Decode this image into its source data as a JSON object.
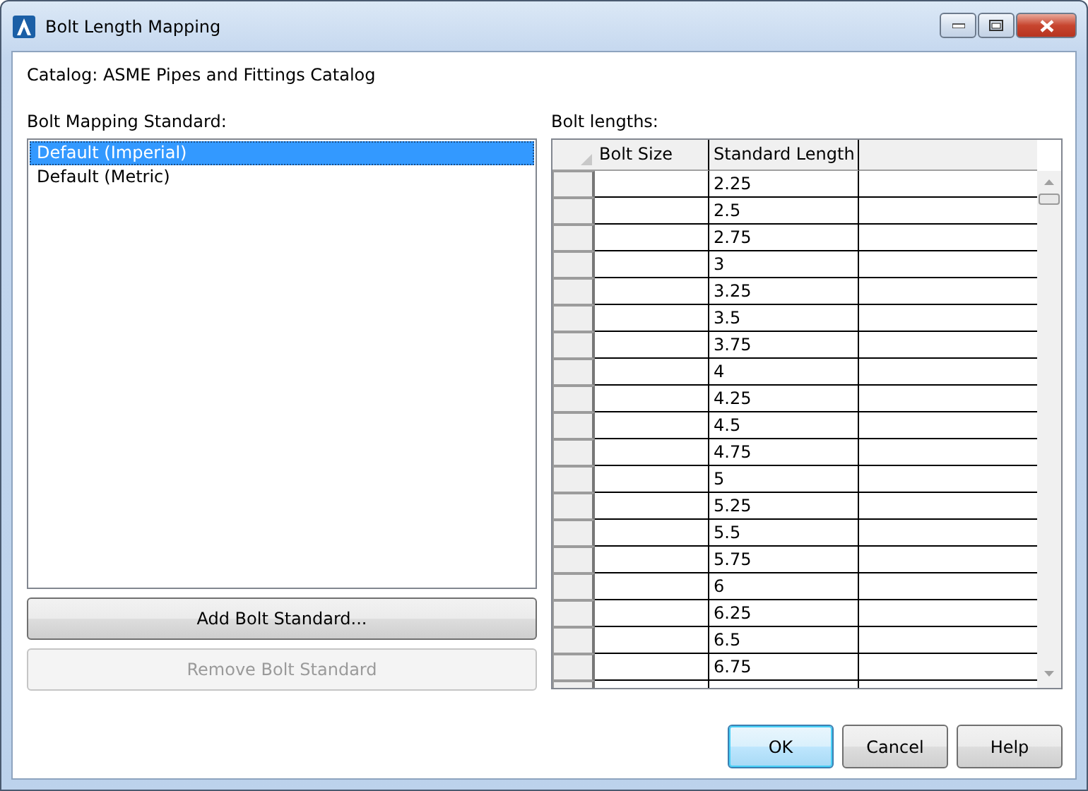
{
  "window": {
    "title": "Bolt Length Mapping"
  },
  "catalog": "Catalog: ASME Pipes and Fittings Catalog",
  "standards": {
    "label": "Bolt Mapping Standard:",
    "items": [
      {
        "label": "Default (Imperial)",
        "selected": true
      },
      {
        "label": "Default (Metric)",
        "selected": false
      }
    ]
  },
  "standard_buttons": [
    {
      "label": "Add Bolt Standard...",
      "disabled": false
    },
    {
      "label": "Remove Bolt Standard",
      "disabled": true
    }
  ],
  "bolt_lengths": {
    "label": "Bolt lengths:",
    "columns": [
      "Bolt Size",
      "Standard Length"
    ],
    "rows": [
      {
        "standard_length": "2.25"
      },
      {
        "standard_length": "2.5"
      },
      {
        "standard_length": "2.75"
      },
      {
        "standard_length": "3"
      },
      {
        "standard_length": "3.25"
      },
      {
        "standard_length": "3.5"
      },
      {
        "standard_length": "3.75"
      },
      {
        "standard_length": "4"
      },
      {
        "standard_length": "4.25"
      },
      {
        "standard_length": "4.5"
      },
      {
        "standard_length": "4.75"
      },
      {
        "standard_length": "5"
      },
      {
        "standard_length": "5.25"
      },
      {
        "standard_length": "5.5"
      },
      {
        "standard_length": "5.75"
      },
      {
        "standard_length": "6"
      },
      {
        "standard_length": "6.25"
      },
      {
        "standard_length": "6.5"
      },
      {
        "standard_length": "6.75"
      }
    ]
  },
  "buttons": [
    {
      "label": "OK",
      "default": true
    },
    {
      "label": "Cancel",
      "default": false
    },
    {
      "label": "Help",
      "default": false
    }
  ]
}
